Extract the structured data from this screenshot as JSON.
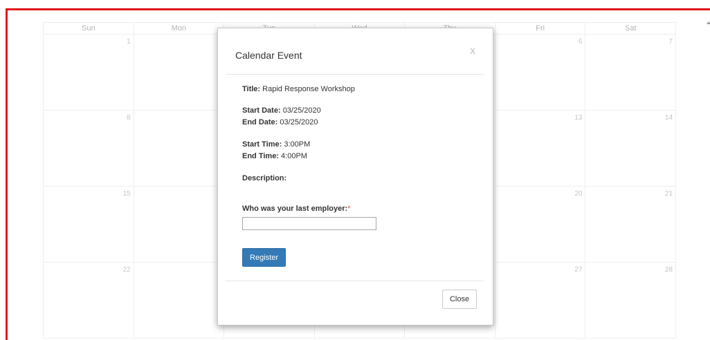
{
  "calendar": {
    "day_headers": [
      "Sun",
      "Mon",
      "Tue",
      "Wed",
      "Thu",
      "Fri",
      "Sat"
    ],
    "weeks": [
      [
        "1",
        "",
        "",
        "",
        "",
        "6",
        "7"
      ],
      [
        "8",
        "",
        "",
        "",
        "",
        "13",
        "14"
      ],
      [
        "15",
        "",
        "",
        "",
        "",
        "20",
        "21"
      ],
      [
        "22",
        "",
        "",
        "",
        "",
        "27",
        "28"
      ]
    ]
  },
  "modal": {
    "title": "Calendar Event",
    "close_x": "X",
    "event_title_label": "Title:",
    "event_title_value": "Rapid Response Workshop",
    "start_date_label": "Start Date:",
    "start_date_value": "03/25/2020",
    "end_date_label": "End Date:",
    "end_date_value": "03/25/2020",
    "start_time_label": "Start Time:",
    "start_time_value": "3:00PM",
    "end_time_label": "End Time:",
    "end_time_value": "4:00PM",
    "description_label": "Description:",
    "employer_label": "Who was your last employer:",
    "required_mark": "*",
    "employer_value": "",
    "register_label": "Register",
    "close_label": "Close"
  },
  "colors": {
    "frame_border": "#e0141b",
    "primary_button": "#337ab7",
    "required": "#d9534f"
  }
}
